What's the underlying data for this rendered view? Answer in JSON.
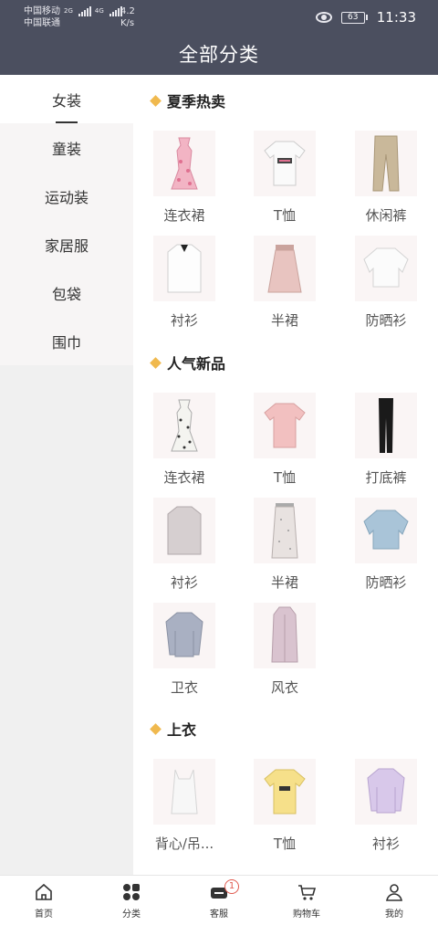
{
  "status_bar": {
    "carrier1": "中国移动",
    "carrier2": "中国联通",
    "sig1_type": "2G",
    "sig2_type": "4G",
    "speed_value": "4.2",
    "speed_unit": "K/s",
    "battery": "63",
    "time": "11:33"
  },
  "header": {
    "title": "全部分类"
  },
  "sidebar": {
    "items": [
      {
        "label": "女装",
        "active": true
      },
      {
        "label": "童装"
      },
      {
        "label": "运动装"
      },
      {
        "label": "家居服"
      },
      {
        "label": "包袋"
      },
      {
        "label": "围巾"
      }
    ]
  },
  "sections": [
    {
      "title": "夏季热卖",
      "items": [
        {
          "label": "连衣裙",
          "icon": "floral-dress-icon"
        },
        {
          "label": "T恤",
          "icon": "white-tshirt-icon"
        },
        {
          "label": "休闲裤",
          "icon": "khaki-pants-icon"
        },
        {
          "label": "衬衫",
          "icon": "white-shirt-icon"
        },
        {
          "label": "半裙",
          "icon": "pink-skirt-icon"
        },
        {
          "label": "防晒衫",
          "icon": "white-cardigan-icon"
        }
      ]
    },
    {
      "title": "人气新品",
      "items": [
        {
          "label": "连衣裙",
          "icon": "print-dress-icon"
        },
        {
          "label": "T恤",
          "icon": "pink-tshirt-icon"
        },
        {
          "label": "打底裤",
          "icon": "black-leggings-icon"
        },
        {
          "label": "衬衫",
          "icon": "gray-shirt-icon"
        },
        {
          "label": "半裙",
          "icon": "long-skirt-icon"
        },
        {
          "label": "防晒衫",
          "icon": "blue-cardigan-icon"
        },
        {
          "label": "卫衣",
          "icon": "gray-sweater-icon"
        },
        {
          "label": "风衣",
          "icon": "trench-coat-icon"
        }
      ]
    },
    {
      "title": "上衣",
      "items": [
        {
          "label": "背心/吊...",
          "icon": "white-camisole-icon"
        },
        {
          "label": "T恤",
          "icon": "yellow-tshirt-icon"
        },
        {
          "label": "衬衫",
          "icon": "purple-hoodie-icon"
        }
      ]
    }
  ],
  "tabbar": {
    "items": [
      {
        "label": "首页",
        "icon": "home-icon"
      },
      {
        "label": "分类",
        "icon": "category-icon"
      },
      {
        "label": "客服",
        "icon": "customer-service-icon",
        "badge": "1"
      },
      {
        "label": "购物车",
        "icon": "cart-icon"
      },
      {
        "label": "我的",
        "icon": "profile-icon"
      }
    ]
  },
  "colors": {
    "header_bg": "#4b4f5f",
    "accent_diamond": "#f0b94e",
    "badge": "#e05a4f"
  }
}
